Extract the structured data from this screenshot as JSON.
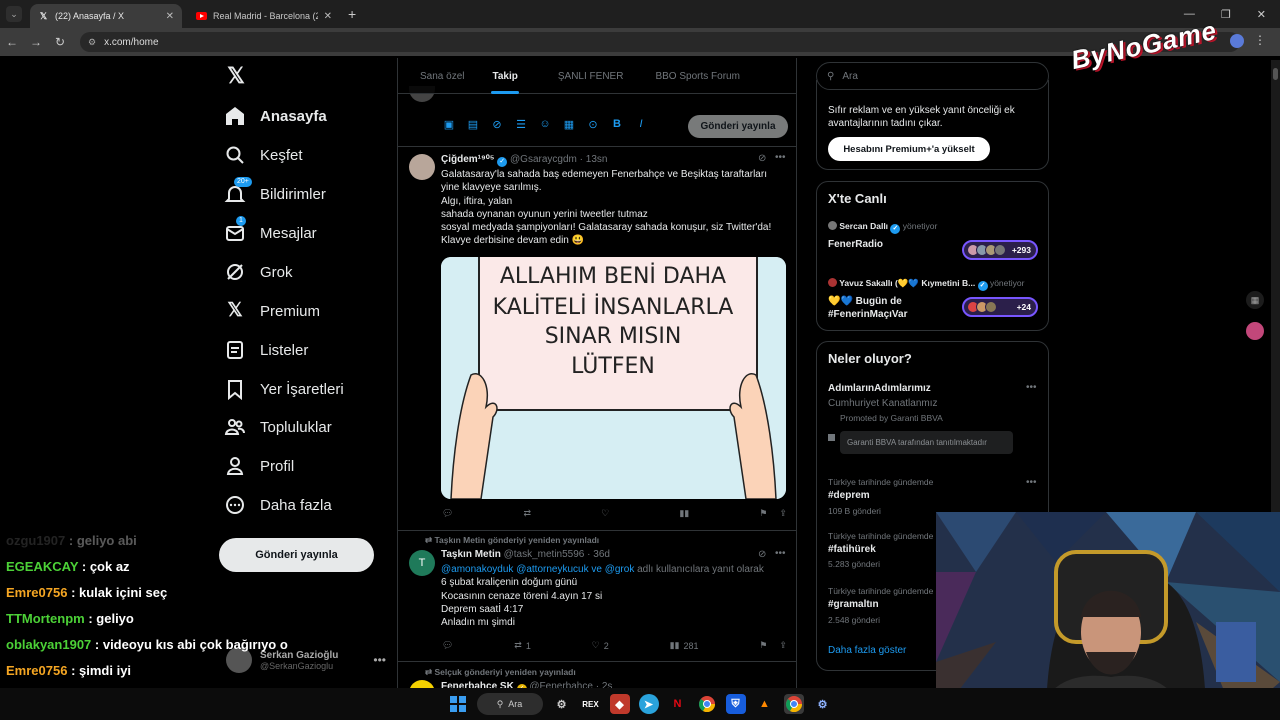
{
  "browser": {
    "tabs": [
      {
        "title": "(22) Anasayfa / X",
        "active": true
      },
      {
        "title": "Real Madrid - Barcelona (2-1) -",
        "active": false
      }
    ],
    "url": "x.com/home"
  },
  "nav": {
    "items": [
      {
        "label": "Anasayfa",
        "icon": "home-icon",
        "active": true
      },
      {
        "label": "Keşfet",
        "icon": "search-icon"
      },
      {
        "label": "Bildirimler",
        "icon": "bell-icon",
        "badge": "20+"
      },
      {
        "label": "Mesajlar",
        "icon": "mail-icon",
        "badge": "1"
      },
      {
        "label": "Grok",
        "icon": "grok-icon"
      },
      {
        "label": "Premium",
        "icon": "x-premium-icon"
      },
      {
        "label": "Listeler",
        "icon": "list-icon"
      },
      {
        "label": "Yer İşaretleri",
        "icon": "bookmark-icon"
      },
      {
        "label": "Topluluklar",
        "icon": "communities-icon"
      },
      {
        "label": "Profil",
        "icon": "profile-icon"
      },
      {
        "label": "Daha fazla",
        "icon": "more-icon"
      }
    ],
    "post_button": "Gönderi yayınla",
    "account": {
      "name": "Serkan Gazioğlu",
      "handle": "@SerkanGazioglu"
    }
  },
  "timeline": {
    "tabs": [
      "Sana özel",
      "Takip",
      "ŞANLI FENER",
      "BBO Sports Forum"
    ],
    "active_tab": "Takip",
    "compose_button": "Gönderi yayınla",
    "tweets": [
      {
        "name": "Çiğdem¹⁹⁰⁵",
        "handle": "@Gsaraycgdm",
        "time": "13sn",
        "lines": [
          "Galatasaray'la sahada baş edemeyen Fenerbahçe ve Beşiktaş taraftarları",
          "yine klavyeye sarılmış.",
          "Algı, iftira, yalan",
          "sahada oynanan oyunun yerini tweetler tutmaz",
          "sosyal medyada şampiyonları! Galatasaray sahada konuşur, siz Twitter'da!",
          "Klavye derbisine devam edin 😃"
        ],
        "image_text": [
          "ALLAHIM BENİ DAHA",
          "KALİTELİ İNSANLARLA",
          "SINAR MISIN",
          "LÜTFEN"
        ]
      },
      {
        "repost_note": "Taşkın Metin gönderiyi yeniden yayınladı",
        "name": "Taşkın Metin",
        "handle": "@task_metin5596",
        "time": "36d",
        "reply_mentions": "@amonakoyduk @attorneykucuk ve @grok",
        "reply_suffix": "adlı kullanıcılara yanıt olarak",
        "lines": [
          "6 şubat kraliçenin doğum günü",
          "Kocasının cenaze töreni 4.ayın 17 si",
          "Deprem saatİ 4:17",
          "Anladın mı şimdi"
        ],
        "reposts": "1",
        "likes": "2",
        "views": "281"
      },
      {
        "repost_note": "Selçuk gönderiyi yeniden yayınladı",
        "name": "Fenerbahçe SK",
        "handle": "@Fenerbahce",
        "time": "2s"
      }
    ]
  },
  "sidebar": {
    "search_placeholder": "Ara",
    "premium": {
      "text": "Sıfır reklam ve en yüksek yanıt önceliği ek avantajlarının tadını çıkar.",
      "button": "Hesabını Premium+'a yükselt"
    },
    "live": {
      "title": "X'te Canlı",
      "items": [
        {
          "host": "Sercan Dallı",
          "role": "yönetiyor",
          "title": "FenerRadio",
          "count": "+293"
        },
        {
          "host": "Yavuz Sakallı (💛💙 Kıymetini B...",
          "role": "yönetiyor",
          "title": "💛💙 Bugün de #FenerinMaçıVar",
          "count": "+24"
        }
      ]
    },
    "trends": {
      "title": "Neler oluyor?",
      "promoted": {
        "name": "AdımlarınAdımlarımız",
        "desc": "Cumhuriyet Kanatlanmız",
        "by": "Promoted by Garanti BBVA",
        "box": "Garanti BBVA tarafından tanıtılmaktadır"
      },
      "items": [
        {
          "ctx": "Türkiye tarihinde gündemde",
          "name": "#deprem",
          "count": "109 B gönderi"
        },
        {
          "ctx": "Türkiye tarihinde gündemde",
          "name": "#fatihürek",
          "count": "5.283 gönderi"
        },
        {
          "ctx": "Türkiye tarihinde gündemde",
          "name": "#gramaltın",
          "count": "2.548 gönderi"
        }
      ],
      "show_more": "Daha fazla göster"
    }
  },
  "stream_chat": [
    {
      "user": "ozgu1907",
      "msg": "geliyo abi",
      "color": "#3a3a3a"
    },
    {
      "user": "EGEAKCAY",
      "msg": "çok az",
      "color": "#4cd137"
    },
    {
      "user": "Emre0756",
      "msg": "kulak içini seç",
      "color": "#f5a623"
    },
    {
      "user": "TTMortenpm",
      "msg": "geliyo",
      "color": "#4cd137"
    },
    {
      "user": "oblakyan1907",
      "msg": "videoyu kıs abi çok bağırıyo o",
      "color": "#4cd137"
    },
    {
      "user": "Emre0756",
      "msg": "şimdi iyi",
      "color": "#f5a623"
    }
  ],
  "overlay_logo": "ByNoGame",
  "taskbar": {
    "search": "Ara"
  }
}
